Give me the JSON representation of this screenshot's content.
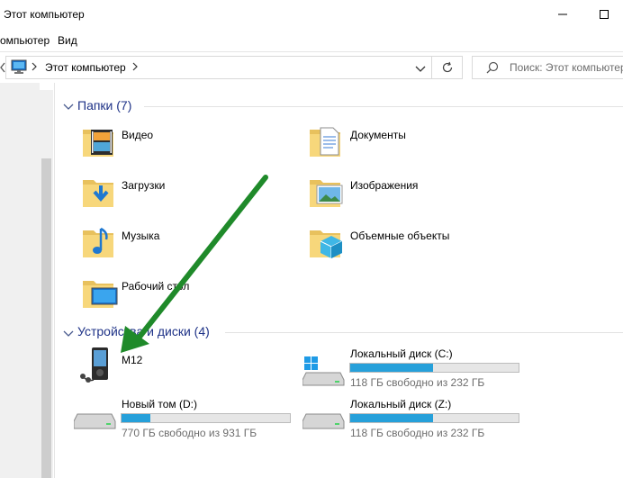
{
  "window": {
    "title": "Этот компьютер"
  },
  "ribbon": {
    "tabs": [
      "омпьютер",
      "Вид"
    ]
  },
  "address": {
    "path": "Этот компьютер",
    "search_placeholder": "Поиск: Этот компьютер"
  },
  "folders": {
    "header": "Папки (7)",
    "items": [
      {
        "label": "Видео",
        "icon": "video-folder-icon"
      },
      {
        "label": "Документы",
        "icon": "documents-folder-icon"
      },
      {
        "label": "Загрузки",
        "icon": "downloads-folder-icon"
      },
      {
        "label": "Изображения",
        "icon": "pictures-folder-icon"
      },
      {
        "label": "Музыка",
        "icon": "music-folder-icon"
      },
      {
        "label": "Объемные объекты",
        "icon": "3d-objects-folder-icon"
      },
      {
        "label": "Рабочий стол",
        "icon": "desktop-folder-icon"
      }
    ]
  },
  "devices": {
    "header": "Устройства и диски (4)",
    "items": [
      {
        "label": "M12",
        "icon": "media-player-icon"
      },
      {
        "label": "Локальный диск (C:)",
        "free": "118 ГБ свободно из 232 ГБ",
        "used_fraction": 0.49,
        "icon": "system-drive-icon"
      },
      {
        "label": "Новый том (D:)",
        "free": "770 ГБ свободно из 931 ГБ",
        "used_fraction": 0.17,
        "icon": "hard-drive-icon"
      },
      {
        "label": "Локальный диск (Z:)",
        "free": "118 ГБ свободно из 232 ГБ",
        "used_fraction": 0.49,
        "icon": "hard-drive-icon"
      }
    ]
  },
  "colors": {
    "accent": "#26a0da",
    "group_header": "#1e3287",
    "annotation_arrow": "#1f8a2a"
  }
}
